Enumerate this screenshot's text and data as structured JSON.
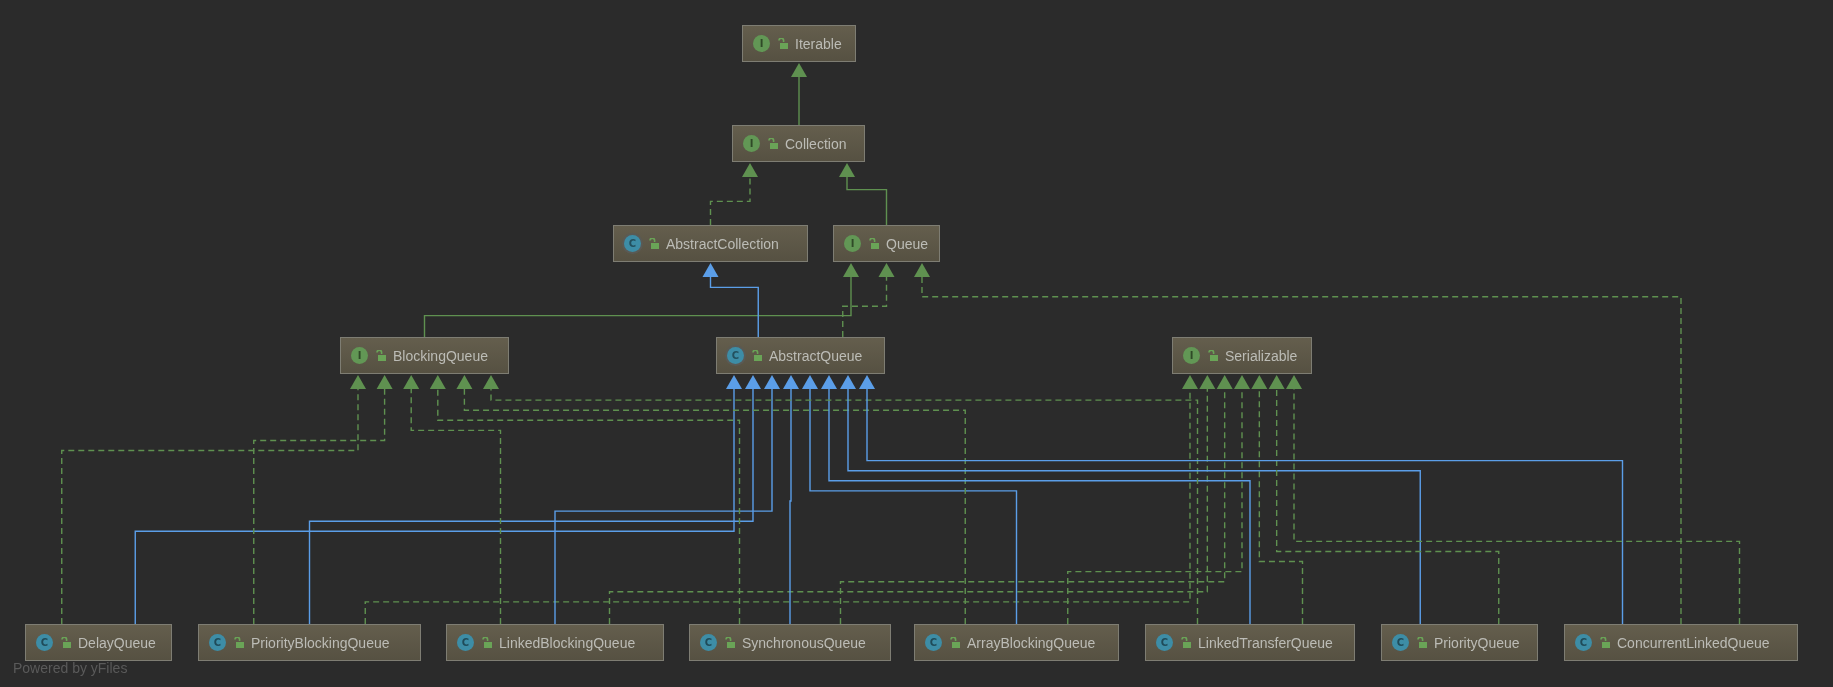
{
  "diagram": {
    "nodes": [
      {
        "name": "Iterable",
        "kind": "interface",
        "badge": "I"
      },
      {
        "name": "Collection",
        "kind": "interface",
        "badge": "I"
      },
      {
        "name": "AbstractCollection",
        "kind": "abstract_class",
        "badge": "C"
      },
      {
        "name": "Queue",
        "kind": "interface",
        "badge": "I"
      },
      {
        "name": "BlockingQueue",
        "kind": "interface",
        "badge": "I"
      },
      {
        "name": "AbstractQueue",
        "kind": "abstract_class",
        "badge": "C"
      },
      {
        "name": "Serializable",
        "kind": "interface",
        "badge": "I"
      },
      {
        "name": "DelayQueue",
        "kind": "class",
        "badge": "C"
      },
      {
        "name": "PriorityBlockingQueue",
        "kind": "class",
        "badge": "C"
      },
      {
        "name": "LinkedBlockingQueue",
        "kind": "class",
        "badge": "C"
      },
      {
        "name": "SynchronousQueue",
        "kind": "class",
        "badge": "C"
      },
      {
        "name": "ArrayBlockingQueue",
        "kind": "class",
        "badge": "C"
      },
      {
        "name": "LinkedTransferQueue",
        "kind": "class",
        "badge": "C"
      },
      {
        "name": "PriorityQueue",
        "kind": "class",
        "badge": "C"
      },
      {
        "name": "ConcurrentLinkedQueue",
        "kind": "class",
        "badge": "C"
      }
    ]
  },
  "footer": "Powered by yFiles"
}
